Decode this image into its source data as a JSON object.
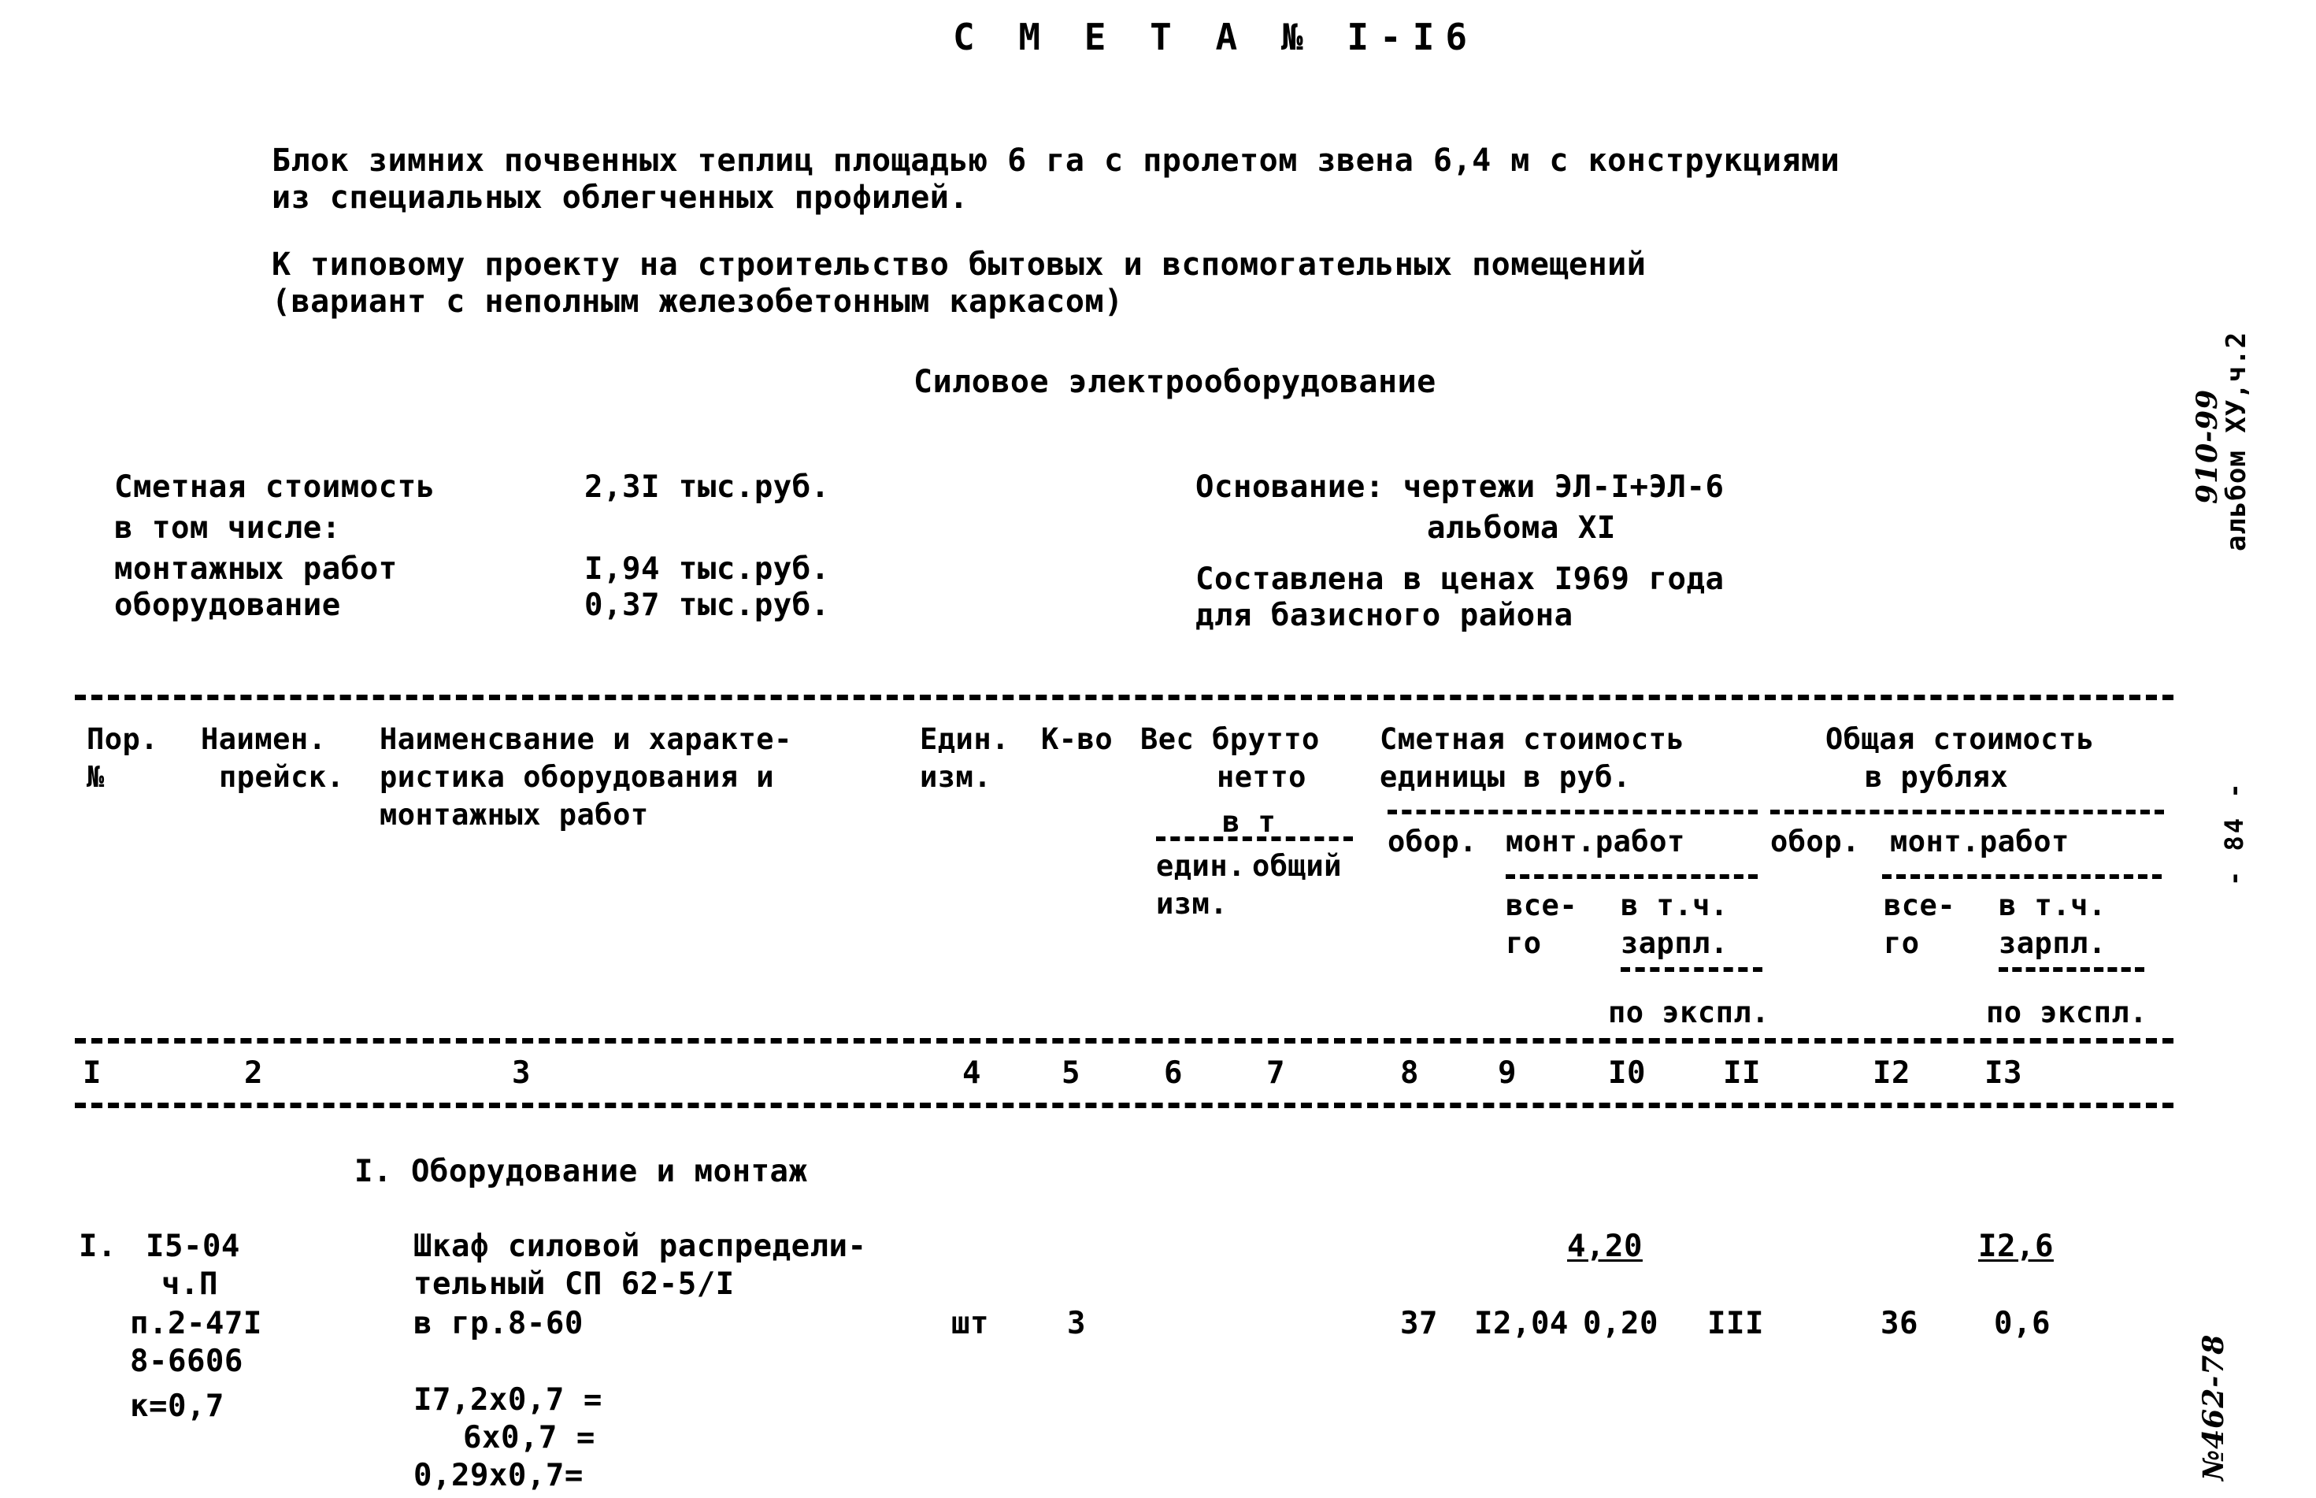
{
  "document": {
    "title": "С М Е Т А № I-I6",
    "intro_line_1": "Блок зимних почвенных теплиц площадью 6 га с пролетом звена 6,4 м с конструкциями",
    "intro_line_2": "из специальных облегченных профилей.",
    "project_line_1": "К типовому проекту на строительство бытовых и вспомогательных помещений",
    "project_line_2": "(вариант с неполным железобетонным каркасом)",
    "section_subtitle": "Силовое электрооборудование"
  },
  "cost_summary": {
    "label_total": "Сметная стоимость",
    "label_including": "в том числе:",
    "label_installation": "монтажных работ",
    "label_equipment": "оборудование",
    "value_total": "2,3I тыс.руб.",
    "value_installation": "I,94 тыс.руб.",
    "value_equipment": "0,37 тыс.руб."
  },
  "basis": {
    "line_1": "Основание: чертежи ЭЛ-I+ЭЛ-6",
    "line_2": "альбома XI",
    "line_3": "Составлена в ценах I969 года",
    "line_4": "для базисного района"
  },
  "table_header": {
    "col1_line1": "Пор.",
    "col1_line2": "№",
    "col2_line1": "Наимен.",
    "col2_line2": "прейск.",
    "col3_line1": "Наименсвание и характе-",
    "col3_line2": "ристика оборудования и",
    "col3_line3": "монтажных работ",
    "col4_line1": "Един.",
    "col4_line2": "изм.",
    "col5": "К-во",
    "col6_line1": "Вес брутто",
    "col6_line2": "нетто",
    "col6_line3": "в т",
    "col6_line4": "един.",
    "col6_line5": "общий",
    "col6_line6": "изм.",
    "unit_cost_title_1": "Сметная стоимость",
    "unit_cost_title_2": "единицы в руб.",
    "unit_cost_equip": "обор.",
    "unit_cost_mont": "монт.работ",
    "unit_cost_all_1": "все-",
    "unit_cost_all_2": "го",
    "unit_cost_wage_1": "в т.ч.",
    "unit_cost_wage_2": "зарпл.",
    "unit_cost_oper": "по экспл.",
    "total_cost_title_1": "Общая стоимость",
    "total_cost_title_2": "в рублях",
    "total_cost_equip": "обор.",
    "total_cost_mont": "монт.работ",
    "total_cost_all_1": "все-",
    "total_cost_all_2": "го",
    "total_cost_wage_1": "в т.ч.",
    "total_cost_wage_2": "зарпл.",
    "total_cost_oper": "по экспл."
  },
  "column_numbers": {
    "c1": "I",
    "c2": "2",
    "c3": "3",
    "c4": "4",
    "c5": "5",
    "c6": "6",
    "c7": "7",
    "c8": "8",
    "c9": "9",
    "c10": "I0",
    "c11": "II",
    "c12": "I2",
    "c13": "I3"
  },
  "section_heading": "I. Оборудование и монтаж",
  "row": {
    "pos_no": "I.",
    "price_ref_1": "I5-04",
    "price_ref_2": "ч.П",
    "price_ref_3": "п.2-47I",
    "price_ref_4": "8-6606",
    "price_ref_5": "к=0,7",
    "name_1": "Шкаф силовой распредели-",
    "name_2": "тельный СП 62-5/I",
    "name_3": "в гр.8-60",
    "calc_1": "I7,2x0,7 =",
    "calc_2": "6x0,7 =",
    "calc_3": "0,29x0,7=",
    "unit": "шт",
    "qty": "3",
    "equip_unit_cost": "37",
    "mont_unit_all": "I2,04",
    "mont_unit_wage": "0,20",
    "mont_unit_oper": "III",
    "equip_total": "36",
    "mont_total_wage": "0,6",
    "mont_unit_all_over": "4,20",
    "mont_total_over": "I2,6"
  },
  "margin_notes": {
    "album": "альбом ХУ,ч.2",
    "album_hand": "910-99",
    "page_number": "- 84 -",
    "bottom_hand": "№462-78"
  }
}
